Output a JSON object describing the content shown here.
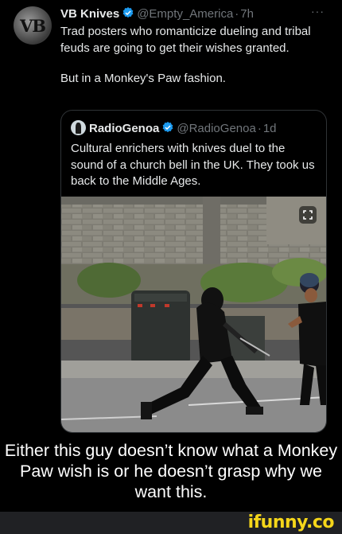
{
  "tweet": {
    "avatar_text": "VB",
    "name": "VB Knives",
    "handle": "@Empty_America",
    "separator": "·",
    "time": "7h",
    "more": "···",
    "paragraphs": [
      "Trad posters who romanticize dueling and tribal feuds are going to get their wishes granted.",
      "But in a Monkey's Paw fashion."
    ]
  },
  "quote": {
    "name": "RadioGenoa",
    "handle": "@RadioGenoa",
    "separator": "·",
    "time": "1d",
    "text": "Cultural enrichers with knives duel to the sound of a church bell in the UK. They took us back to the Middle Ages."
  },
  "caption": "Either this guy doesn’t know what a Monkey Paw wish is or he doesn’t grasp why we want this.",
  "watermark": "ifunny.co",
  "colors": {
    "background": "#000000",
    "text": "#e7e9ea",
    "muted": "#71767b",
    "verified": "#1d9bf0",
    "border": "#2f3336",
    "watermark": "#f5d61a"
  }
}
